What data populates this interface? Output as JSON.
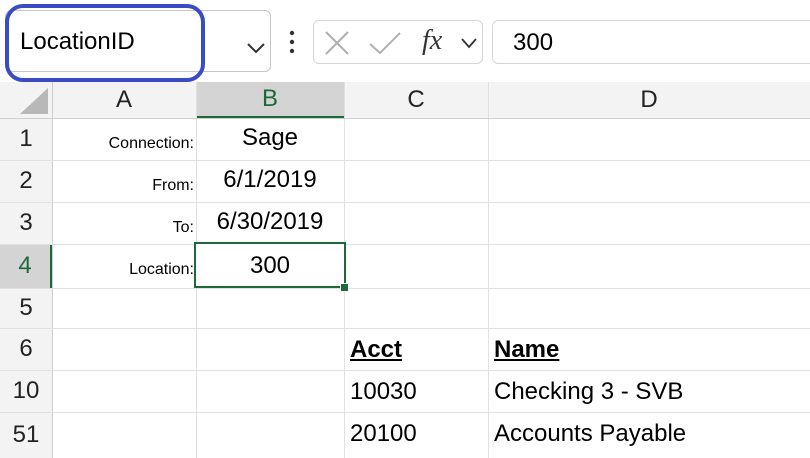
{
  "namebox": {
    "value": "LocationID"
  },
  "formula_bar": {
    "value": "300",
    "fx_label": "fx"
  },
  "columns": [
    "A",
    "B",
    "C",
    "D"
  ],
  "rows": [
    "1",
    "2",
    "3",
    "4",
    "5",
    "6",
    "10",
    "51"
  ],
  "cells": {
    "A1": "Connection:",
    "B1": "Sage",
    "A2": "From:",
    "B2": "6/1/2019",
    "A3": "To:",
    "B3": "6/30/2019",
    "A4": "Location:",
    "B4": "300",
    "C6": "Acct",
    "D6": "Name",
    "C10": "10030",
    "D10": "Checking 3 - SVB",
    "C51": "20100",
    "D51": "Accounts Payable"
  },
  "active_cell": "B4",
  "colors": {
    "highlight": "#3a4cc4",
    "selection": "#1d6a38"
  },
  "icons": [
    "chevron-down-icon",
    "more-vertical-icon",
    "cancel-icon",
    "enter-check-icon",
    "fx-icon",
    "select-all-triangle-icon"
  ]
}
